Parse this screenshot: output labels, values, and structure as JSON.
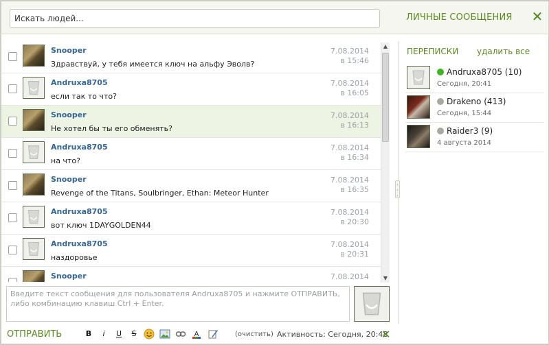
{
  "header": {
    "search_placeholder": "Искать людей...",
    "title": "ЛИЧНЫЕ СООБЩЕНИЯ"
  },
  "messages": [
    {
      "name": "Snooper",
      "text": "Здравствуй, у тебя имеется ключ на альфу Эволв?",
      "date": "7.08.2014",
      "time": "в 15:46",
      "avatar": "snooper"
    },
    {
      "name": "Andruxa8705",
      "text": "если так то что?",
      "date": "7.08.2014",
      "time": "в 16:05",
      "avatar": "default"
    },
    {
      "name": "Snooper",
      "text": "Не хотел бы ты его обменять?",
      "date": "7.08.2014",
      "time": "в 16:13",
      "avatar": "snooper"
    },
    {
      "name": "Andruxa8705",
      "text": "на что?",
      "date": "7.08.2014",
      "time": "в 16:34",
      "avatar": "default"
    },
    {
      "name": "Snooper",
      "text": "Revenge of the Titans, Soulbringer, Ethan: Meteor Hunter",
      "date": "7.08.2014",
      "time": "в 16:35",
      "avatar": "snooper"
    },
    {
      "name": "Andruxa8705",
      "text": "вот ключ 1DAYGOLDEN44",
      "date": "7.08.2014",
      "time": "в 20:30",
      "avatar": "default"
    },
    {
      "name": "Andruxa8705",
      "text": "наздоровье",
      "date": "7.08.2014",
      "time": "в 20:31",
      "avatar": "default"
    },
    {
      "name": "Snooper",
      "text": "",
      "date": "7.08.2014",
      "time": "",
      "avatar": "snooper"
    }
  ],
  "compose": {
    "placeholder": "Введите текст сообщения для пользователя Andruxa8705 и нажмите ОТПРАВИТЬ, либо комбинацию клавиш Ctrl + Enter."
  },
  "footer": {
    "send_label": "ОТПРАВИТЬ",
    "toolbar": {
      "bold": "B",
      "italic": "i",
      "underline": "U",
      "strike": "S"
    },
    "clear_label": "(очистить)",
    "activity": "Активность: Сегодня, 20:48"
  },
  "conversations_panel": {
    "title": "ПЕРЕПИСКИ",
    "delete_all": "удалить все",
    "items": [
      {
        "label": "Andruxa8705 (10)",
        "time": "Сегодня, 20:41",
        "status_color": "#3cb521",
        "avatar": "default"
      },
      {
        "label": "Drakeno (413)",
        "time": "Сегодня, 15:44",
        "status_color": "#a9a9a0",
        "avatar": "drakeno"
      },
      {
        "label": "Raider3 (9)",
        "time": "4 августа 2014",
        "status_color": "#a9a9a0",
        "avatar": "raider"
      }
    ]
  },
  "colors": {
    "accent": "#5a8a1c",
    "name_link": "#336699",
    "online": "#3cb521",
    "offline": "#a9a9a0"
  }
}
